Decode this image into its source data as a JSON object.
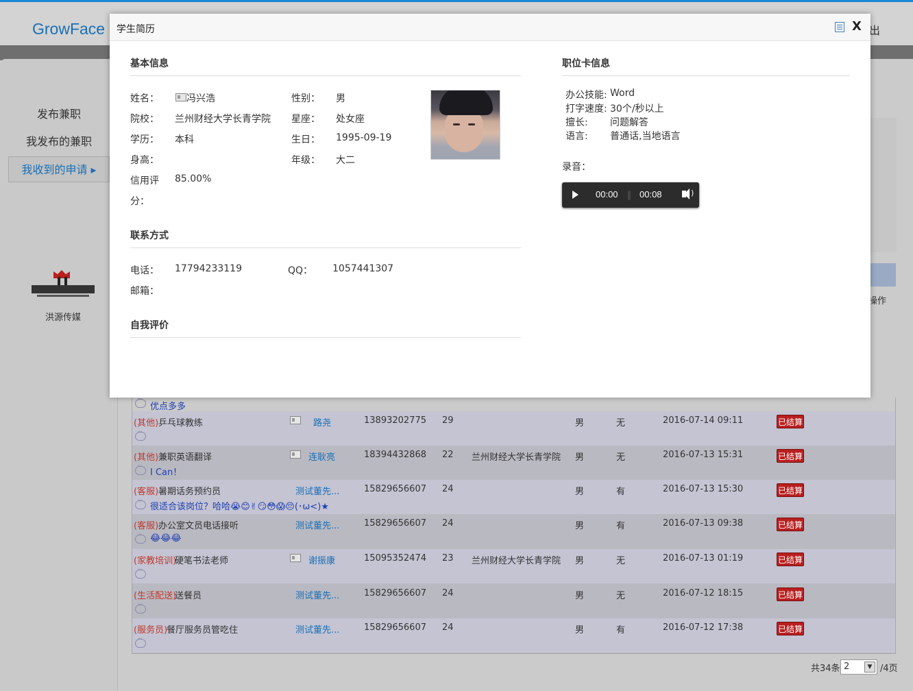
{
  "header": {
    "logo": "GrowFace",
    "logout": "出"
  },
  "sidebar": {
    "items": [
      {
        "label": "发布兼职"
      },
      {
        "label": "我发布的兼职"
      },
      {
        "label": "我收到的申请 ▸"
      }
    ],
    "brand_name": "洪源传媒"
  },
  "grid": {
    "op_header": "操作"
  },
  "modal": {
    "title": "学生简历",
    "close": "X",
    "basic": {
      "section": "基本信息",
      "name_label": "姓名：",
      "name": "冯兴浩",
      "gender_label": "性别：",
      "gender": "男",
      "school_label": "院校：",
      "school": "兰州财经大学长青学院",
      "zodiac_label": "星座：",
      "zodiac": "处女座",
      "edu_label": "学历：",
      "edu": "本科",
      "birthday_label": "生日：",
      "birthday": "1995-09-19",
      "height_label": "身高：",
      "height": "",
      "grade_label": "年级：",
      "grade": "大二",
      "credit_label_1": "信用评",
      "credit_label_2": "分：",
      "credit": "85.00%"
    },
    "contact": {
      "section": "联系方式",
      "phone_label": "电话：",
      "phone": "17794233119",
      "qq_label": "QQ：",
      "qq": "1057441307",
      "email_label": "邮箱：",
      "email": ""
    },
    "self_eval": {
      "section": "自我评价"
    },
    "job_card": {
      "section": "职位卡信息",
      "skill_label": "办公技能:",
      "skill": "Word",
      "typing_label": "打字速度:",
      "typing": "30个/秒以上",
      "strength_label": "擅长:",
      "strength": "问题解答",
      "language_label": "语言:",
      "language": "普通话,当地语言",
      "audio_label": "录音：",
      "audio_current": "00:00",
      "audio_duration": "00:08"
    }
  },
  "table": {
    "top_comment": "优点多多",
    "rows": [
      {
        "category": "(其他)",
        "job": "乒乓球教练",
        "name": "路尧",
        "has_card": true,
        "phone": "13893202775",
        "age": "29",
        "school": "",
        "gender": "男",
        "exp": "无",
        "time": "2016-07-14 09:11",
        "status": "已结算",
        "comment": ""
      },
      {
        "category": "(其他)",
        "job": "兼职英语翻译",
        "name": "连耿亮",
        "has_card": true,
        "phone": "18394432868",
        "age": "22",
        "school": "兰州财经大学长青学院",
        "gender": "男",
        "exp": "无",
        "time": "2016-07-13 15:31",
        "status": "已结算",
        "comment": "I Can！"
      },
      {
        "category": "(客服)",
        "job": "暑期话务预约员",
        "name": "测试董先...",
        "has_card": false,
        "phone": "15829656607",
        "age": "24",
        "school": "",
        "gender": "男",
        "exp": "有",
        "time": "2016-07-13 15:30",
        "status": "已结算",
        "comment": "很适合该岗位？哈哈😭😊✌😏😳😱😔(･ω<)★"
      },
      {
        "category": "(客服)",
        "job": "办公室文员电话接听",
        "name": "测试董先...",
        "has_card": false,
        "phone": "15829656607",
        "age": "24",
        "school": "",
        "gender": "男",
        "exp": "有",
        "time": "2016-07-13 09:38",
        "status": "已结算",
        "comment": "😂😂😂"
      },
      {
        "category": "(家教培训)",
        "job": "硬笔书法老师",
        "name": "谢振康",
        "has_card": true,
        "phone": "15095352474",
        "age": "23",
        "school": "兰州财经大学长青学院",
        "gender": "男",
        "exp": "无",
        "time": "2016-07-13 01:19",
        "status": "已结算",
        "comment": ""
      },
      {
        "category": "(生活配送)",
        "job": "送餐员",
        "name": "测试董先...",
        "has_card": false,
        "phone": "15829656607",
        "age": "24",
        "school": "",
        "gender": "男",
        "exp": "无",
        "time": "2016-07-12 18:15",
        "status": "已结算",
        "comment": ""
      },
      {
        "category": "(服务员)",
        "job": "餐厅服务员管吃住",
        "name": "测试董先...",
        "has_card": false,
        "phone": "15829656607",
        "age": "24",
        "school": "",
        "gender": "男",
        "exp": "有",
        "time": "2016-07-12 17:38",
        "status": "已结算",
        "comment": ""
      }
    ]
  },
  "pager": {
    "total": "共34条",
    "page": "2",
    "tail": "/4页"
  }
}
